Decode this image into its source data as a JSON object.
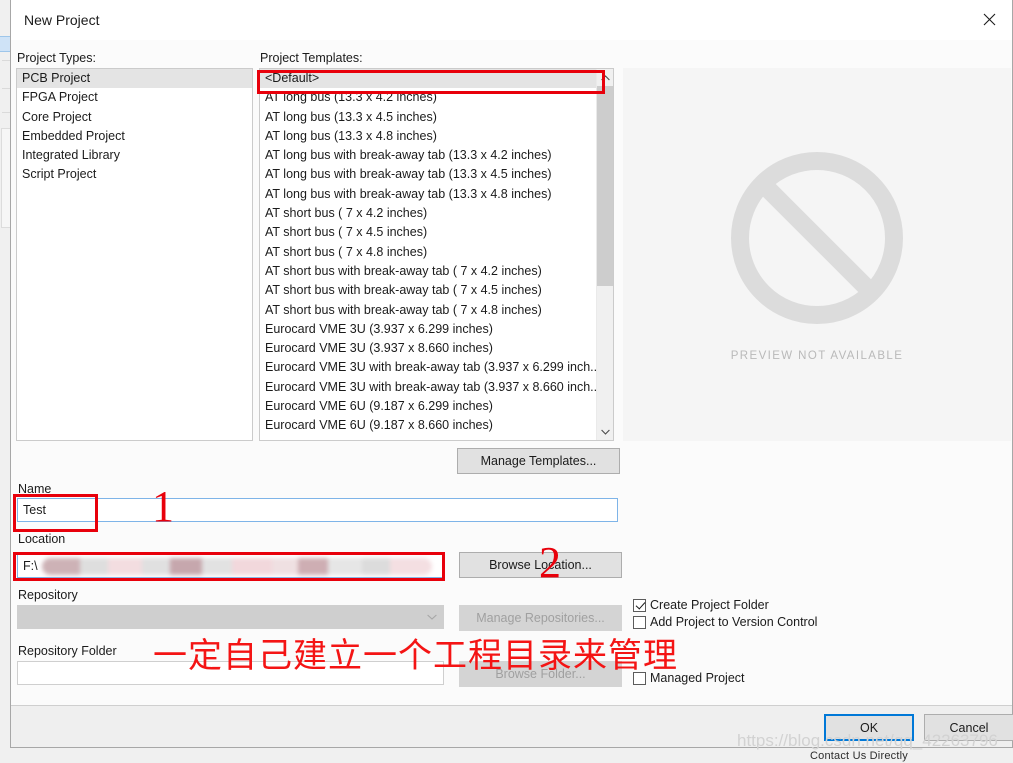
{
  "window": {
    "title": "New Project",
    "close_icon": "close-icon"
  },
  "labels": {
    "project_types": "Project Types:",
    "project_templates": "Project Templates:",
    "name": "Name",
    "location": "Location",
    "repository": "Repository",
    "repository_folder": "Repository Folder"
  },
  "project_types": [
    "PCB Project",
    "FPGA Project",
    "Core Project",
    "Embedded Project",
    "Integrated Library",
    "Script Project"
  ],
  "project_types_selected": "PCB Project",
  "project_templates": [
    "<Default>",
    "AT long bus (13.3 x 4.2 inches)",
    "AT long bus (13.3 x 4.5 inches)",
    "AT long bus (13.3 x 4.8 inches)",
    "AT long bus with break-away tab (13.3 x 4.2 inches)",
    "AT long bus with break-away tab (13.3 x 4.5 inches)",
    "AT long bus with break-away tab (13.3 x 4.8 inches)",
    "AT short bus ( 7 x 4.2 inches)",
    "AT short bus ( 7 x 4.5 inches)",
    "AT short bus ( 7 x 4.8 inches)",
    "AT short bus with break-away tab ( 7 x 4.2 inches)",
    "AT short bus with break-away tab ( 7 x 4.5 inches)",
    "AT short bus with break-away tab ( 7 x 4.8 inches)",
    "Eurocard VME 3U (3.937 x 6.299 inches)",
    "Eurocard VME 3U (3.937 x 8.660 inches)",
    "Eurocard VME 3U with break-away tab (3.937 x 6.299 inch...",
    "Eurocard VME 3U with break-away tab (3.937 x 8.660 inch...",
    "Eurocard VME 6U (9.187 x 6.299 inches)",
    "Eurocard VME 6U (9.187 x 8.660 inches)"
  ],
  "project_templates_selected": "<Default>",
  "preview": {
    "caption": "PREVIEW NOT AVAILABLE",
    "icon": "no-entry-icon"
  },
  "buttons": {
    "manage_templates": "Manage Templates...",
    "browse_location": "Browse Location...",
    "manage_repositories": "Manage Repositories...",
    "browse_folder": "Browse Folder...",
    "ok": "OK",
    "cancel": "Cancel"
  },
  "fields": {
    "name_value": "Test",
    "location_value": "F:\\",
    "repository_value": "",
    "repository_folder_value": ""
  },
  "checkboxes": [
    {
      "label": "Create Project Folder",
      "checked": true
    },
    {
      "label": "Add Project to Version Control",
      "checked": false
    },
    {
      "label": "Managed Project",
      "checked": false
    }
  ],
  "annotations": {
    "marker_1": "1",
    "marker_2": "2",
    "chinese_note": "一定自己建立一个工程目录来管理",
    "accent_color": "#e8000b"
  },
  "watermark": {
    "url": "https://blog.csdn.net/qq_42263796"
  },
  "background": {
    "bottom_text": "Contact Us Directly"
  }
}
